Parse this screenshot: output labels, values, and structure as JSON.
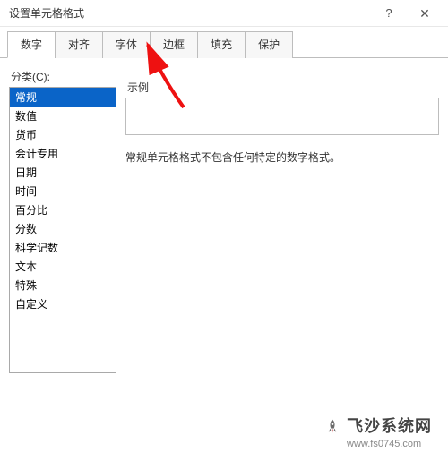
{
  "window": {
    "title": "设置单元格格式"
  },
  "titlebar": {
    "help": "?",
    "close": "✕"
  },
  "tabs": [
    {
      "label": "数字",
      "active": true
    },
    {
      "label": "对齐",
      "active": false
    },
    {
      "label": "字体",
      "active": false
    },
    {
      "label": "边框",
      "active": false
    },
    {
      "label": "填充",
      "active": false
    },
    {
      "label": "保护",
      "active": false
    }
  ],
  "panel": {
    "category_label": "分类(C):",
    "categories": [
      "常规",
      "数值",
      "货币",
      "会计专用",
      "日期",
      "时间",
      "百分比",
      "分数",
      "科学记数",
      "文本",
      "特殊",
      "自定义"
    ],
    "selected_index": 0,
    "sample_label": "示例",
    "description": "常规单元格格式不包含任何特定的数字格式。"
  },
  "watermark": {
    "brand": "飞沙系统网",
    "url": "www.fs0745.com"
  }
}
